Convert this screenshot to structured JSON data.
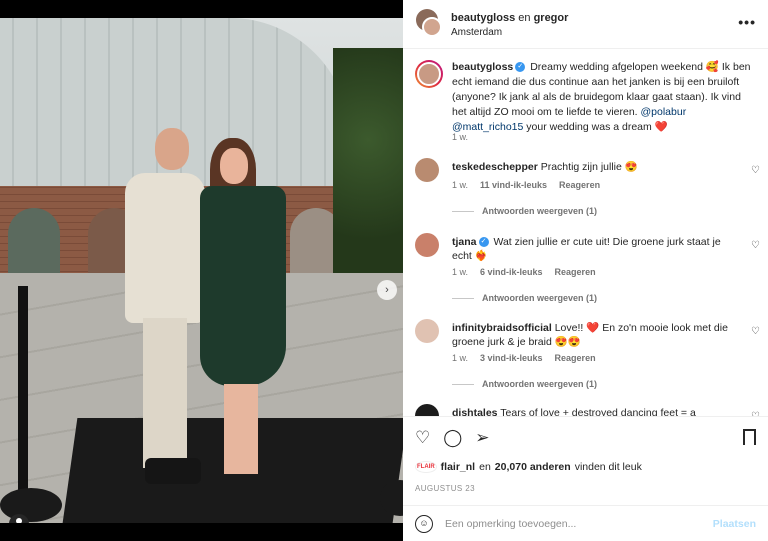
{
  "post": {
    "author": "beautygloss",
    "conjunction": "en",
    "coauthor": "gregor",
    "location": "Amsterdam",
    "more_icon": "more-horizontal-icon"
  },
  "caption": {
    "username": "beautygloss",
    "text_before": "Dreamy wedding afgelopen weekend 🥰 Ik ben echt iemand die dus continue aan het janken is bij een bruiloft (anyone? Ik jank al als de bruidegom klaar gaat staan). Ik vind het altijd ZO mooi om te liefde te vieren.",
    "mention1": "@polabur",
    "mention2": "@matt_richo15",
    "text_after": "your wedding was a dream ❤️",
    "time": "1 w."
  },
  "comments": [
    {
      "username": "teskedeschepper",
      "text": "Prachtig zijn jullie 😍",
      "time": "1 w.",
      "likes": "11 vind-ik-leuks",
      "reply_label": "Reageren",
      "view_replies": "Antwoorden weergeven (1)",
      "avatar_color": "#b98b70"
    },
    {
      "username": "tjana",
      "text": "Wat zien jullie er cute uit! Die groene jurk staat je echt ❤️‍🔥",
      "time": "1 w.",
      "likes": "6 vind-ik-leuks",
      "reply_label": "Reageren",
      "view_replies": "Antwoorden weergeven (1)",
      "avatar_color": "#c9806a"
    },
    {
      "username": "infinitybraidsofficial",
      "text": "Love!! ❤️ En zo'n mooie look met die groene jurk & je braid 😍😍",
      "time": "1 w.",
      "likes": "3 vind-ik-leuks",
      "reply_label": "Reageren",
      "view_replies": "Antwoorden weergeven (1)",
      "avatar_color": "#e0c2b2"
    },
    {
      "username": "dishtales",
      "text": "Tears of love + destroyed dancing feet = a",
      "avatar_color": "#1c1c1c"
    }
  ],
  "actions": {
    "like_icon": "heart-icon",
    "comment_icon": "comment-icon",
    "share_icon": "send-icon",
    "save_icon": "bookmark-icon"
  },
  "likes": {
    "badge": "FLAIR",
    "user": "flair_nl",
    "middle": "en",
    "count": "20,070 anderen",
    "suffix": "vinden dit leuk"
  },
  "date": "AUGUSTUS 23",
  "composer": {
    "placeholder": "Een opmerking toevoegen...",
    "post_label": "Plaatsen"
  },
  "carousel": {
    "slides": 4,
    "active": 1
  },
  "colors": {
    "accent": "#3897f0",
    "mention": "#00376b",
    "post_disabled": "#b2dffc"
  }
}
